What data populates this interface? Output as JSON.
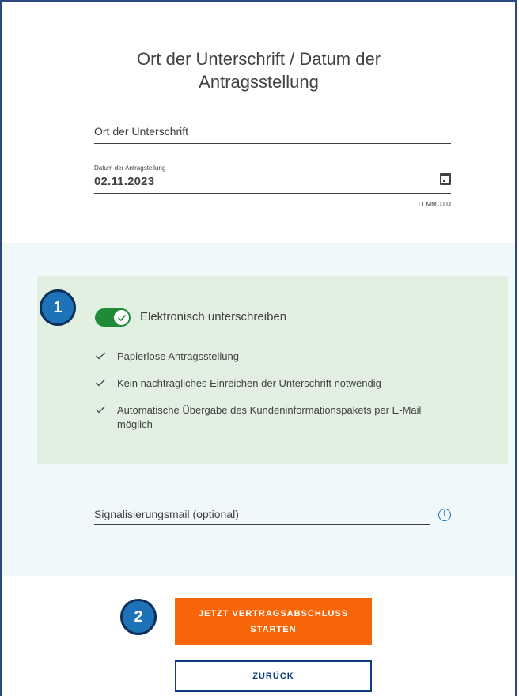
{
  "header": {
    "title": "Ort der Unterschrift / Datum der Antragsstellung"
  },
  "form": {
    "ort_placeholder": "Ort der Unterschrift",
    "date_label": "Datum der Antragstellung",
    "date_value": "02.11.2023",
    "date_format_hint": "TT.MM.JJJJ"
  },
  "esign": {
    "badge": "1",
    "toggle_label": "Elektronisch unterschreiben",
    "toggle_on": true,
    "benefits": [
      "Papierlose Antragsstellung",
      "Kein nachträgliches Einreichen der Unterschrift notwendig",
      "Automatische Übergabe des Kundeninformationspakets per E-Mail möglich"
    ],
    "mail_placeholder": "Signalisierungsmail (optional)",
    "info_icon": "info-icon"
  },
  "actions": {
    "badge": "2",
    "primary_label": "JETZT VERTRAGSABSCHLUSS STARTEN",
    "secondary_label": "ZURÜCK"
  },
  "colors": {
    "accent": "#f66608",
    "navy": "#0a3d7a",
    "toggle_green": "#1f8a38",
    "panel_green": "#e1f0e1",
    "panel_light": "#f1f8fa",
    "badge_blue": "#1e73b8"
  }
}
